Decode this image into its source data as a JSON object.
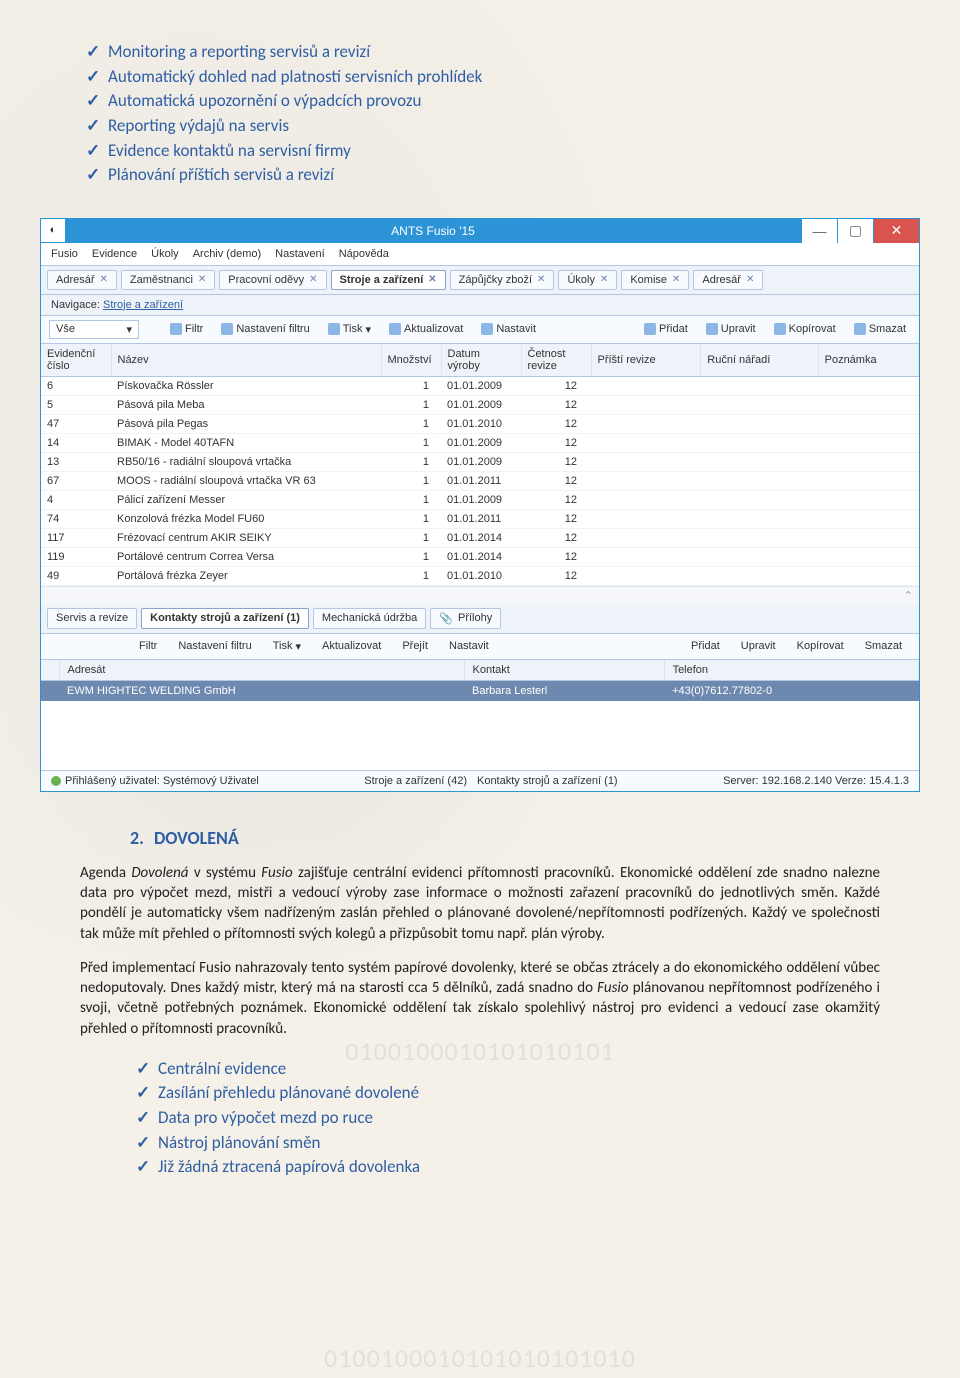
{
  "bullets_top": [
    "Monitoring a reporting servisů a revizí",
    "Automatický dohled nad platností servisních prohlídek",
    "Automatická upozornění o výpadcích provozu",
    "Reporting výdajů na servis",
    "Evidence kontaktů na servisní firmy",
    "Plánování příštích servisů a revizí"
  ],
  "window": {
    "title": "ANTS Fusio '15",
    "menu": [
      "Fusio",
      "Evidence",
      "Úkoly",
      "Archiv (demo)",
      "Nastavení",
      "Nápověda"
    ],
    "tabs": [
      "Adresář",
      "Zaměstnanci",
      "Pracovní oděvy",
      "Stroje a zařízení",
      "Zápůjčky zboží",
      "Úkoly",
      "Komise",
      "Adresář"
    ],
    "active_tab": "Stroje a zařízení",
    "nav_label": "Navigace:",
    "nav_link": "Stroje a zařízení",
    "filter_select": "Vše",
    "toolbar1": [
      "Filtr",
      "Nastavení filtru",
      "Tisk",
      "Aktualizovat",
      "Nastavit"
    ],
    "toolbar1r": [
      "Přidat",
      "Upravit",
      "Kopírovat",
      "Smazat"
    ],
    "cols": [
      "Evidenční číslo",
      "Název",
      "Množství",
      "Datum výroby",
      "Četnost revize",
      "Příští revize",
      "Ruční nářadí",
      "Poznámka"
    ],
    "rows": [
      {
        "id": "6",
        "name": "Pískovačka Rössler",
        "qty": "1",
        "date": "01.01.2009",
        "freq": "12"
      },
      {
        "id": "5",
        "name": "Pásová pila Meba",
        "qty": "1",
        "date": "01.01.2009",
        "freq": "12"
      },
      {
        "id": "47",
        "name": "Pásová pila Pegas",
        "qty": "1",
        "date": "01.01.2010",
        "freq": "12"
      },
      {
        "id": "14",
        "name": "BIMAK - Model 40TAFN",
        "qty": "1",
        "date": "01.01.2009",
        "freq": "12"
      },
      {
        "id": "13",
        "name": "RB50/16 - radiální sloupová vrtačka",
        "qty": "1",
        "date": "01.01.2009",
        "freq": "12"
      },
      {
        "id": "67",
        "name": "MOOS - radiální sloupová vrtačka VR 63",
        "qty": "1",
        "date": "01.01.2011",
        "freq": "12"
      },
      {
        "id": "4",
        "name": "Pálicí zařízení Messer",
        "qty": "1",
        "date": "01.01.2009",
        "freq": "12"
      },
      {
        "id": "74",
        "name": "Konzolová frézka Model FU60",
        "qty": "1",
        "date": "01.01.2011",
        "freq": "12"
      },
      {
        "id": "117",
        "name": "Frézovací centrum AKIR SEIKY",
        "qty": "1",
        "date": "01.01.2014",
        "freq": "12"
      },
      {
        "id": "119",
        "name": "Portálové centrum Correa Versa",
        "qty": "1",
        "date": "01.01.2014",
        "freq": "12"
      },
      {
        "id": "49",
        "name": "Portálová frézka Zeyer",
        "qty": "1",
        "date": "01.01.2010",
        "freq": "12"
      }
    ],
    "lowertabs": [
      "Servis a revize",
      "Kontakty strojů a zařízení (1)",
      "Mechanická údržba",
      "Přílohy"
    ],
    "lower_active": "Kontakty strojů a zařízení (1)",
    "toolbar2": [
      "Filtr",
      "Nastavení filtru",
      "Tisk",
      "Aktualizovat",
      "Přejít",
      "Nastavit"
    ],
    "toolbar2r": [
      "Přidat",
      "Upravit",
      "Kopírovat",
      "Smazat"
    ],
    "contact_cols": [
      "Adresát",
      "Kontakt",
      "Telefon"
    ],
    "contact_row": {
      "a": "EWM HIGHTEC WELDING GmbH",
      "b": "Barbara Lesterl",
      "c": "+43(0)7612.77802-0"
    },
    "status_left": "Přihlášený uživatel: Systémový Uživatel",
    "status_mid1": "Stroje a zařízení (42)",
    "status_mid2": "Kontakty strojů a zařízení (1)",
    "status_right": "Server: 192.168.2.140   Verze: 15.4.1.3"
  },
  "section2": {
    "num": "2.",
    "title": "DOVOLENÁ",
    "p1": "Agenda Dovolená v systému Fusio zajišťuje centrální evidenci přítomnosti pracovníků. Ekonomické oddělení zde snadno nalezne data pro výpočet mezd, mistři a vedoucí výroby zase informace o možnosti zařazení pracovníků do jednotlivých směn. Každé pondělí je automaticky všem nadřízeným zaslán přehled o plánované dovolené/nepřítomnosti podřízených. Každý ve společnosti tak může mít přehled o přítomnosti svých kolegů a přizpůsobit tomu např. plán výroby.",
    "p2": "Před implementací Fusio nahrazovaly tento systém papírové dovolenky, které se občas ztrácely a do ekonomického oddělení vůbec nedoputovaly. Dnes každý mistr, který má na starosti cca 5 dělníků, zadá snadno do Fusio plánovanou nepřítomnost podřízeného i svoji, včetně potřebných poznámek. Ekonomické oddělení tak získalo spolehlivý nástroj pro evidenci a vedoucí zase okamžitý přehled o přítomnosti pracovníků."
  },
  "bullets_bottom": [
    "Centrální evidence",
    "Zasílání přehledu plánované dovolené",
    "Data pro výpočet mezd po ruce",
    "Nástroj plánování směn",
    "Již žádná ztracená papírová dovolenka"
  ]
}
